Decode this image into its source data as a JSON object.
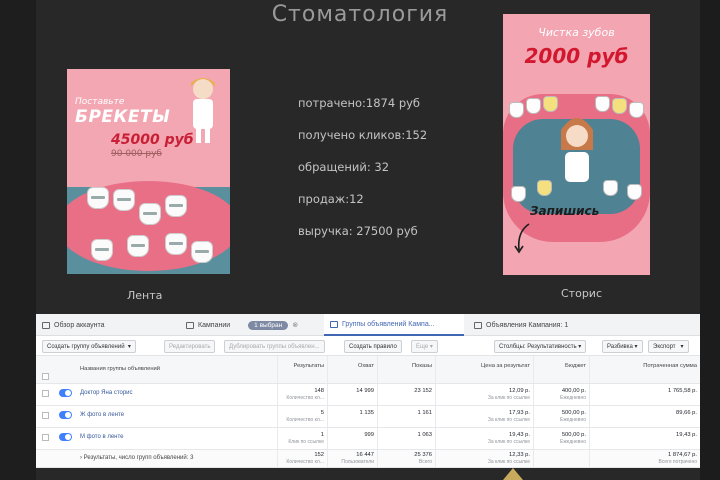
{
  "page": {
    "title": "Стоматология",
    "label_feed": "Лента",
    "label_stories": "Сторис"
  },
  "creative_feed": {
    "line1": "Поставьте",
    "line2": "БРЕКЕТЫ",
    "price": "45000 руб",
    "old_price": "90 000 руб"
  },
  "creative_stories": {
    "line1": "Чистка зубов",
    "price": "2000 руб",
    "cta": "Запишись"
  },
  "stats": [
    "потрачено:1874 руб",
    "получено кликов:152",
    "обращений: 32",
    "продаж:12",
    "выручка: 27500 руб"
  ],
  "ads_manager": {
    "tabs": {
      "overview": "Обзор аккаунта",
      "campaigns": "Кампании",
      "selected": "1 выбран",
      "adsets": "Группы объявлений Кампа...",
      "ads": "Объявления Кампания: 1"
    },
    "toolbar": {
      "create": "Создать группу объявлений",
      "edit": "Редактировать",
      "duplicate": "Дублировать группы объявлен...",
      "rule": "Создать правило",
      "more": "Еще",
      "columns": "Столбцы: Результативность",
      "breakdown": "Разбивка",
      "export": "Экспорт"
    },
    "headers": {
      "name": "Названия группы объявлений",
      "results": "Результаты",
      "reach": "Охват",
      "impressions": "Показы",
      "cost": "Цена за результат",
      "budget": "Бюджет",
      "spent": "Потраченная сумма"
    },
    "rows": [
      {
        "name": "Доктор Яна сторис",
        "results": "148",
        "results_sub": "Количество кл...",
        "reach": "14 999",
        "impressions": "23 152",
        "cost": "12,09 р.",
        "cost_sub": "За клик по ссылке",
        "budget": "400,00 р.",
        "budget_sub": "Ежедневно",
        "spent": "1 765,58 р."
      },
      {
        "name": "Ж фото в ленте",
        "results": "5",
        "results_sub": "Количество кл...",
        "reach": "1 135",
        "impressions": "1 161",
        "cost": "17,93 р.",
        "cost_sub": "За клик по ссылке",
        "budget": "500,00 р.",
        "budget_sub": "Ежедневно",
        "spent": "89,66 р."
      },
      {
        "name": "М фото в ленте",
        "results": "1",
        "results_sub": "Клик по ссылке",
        "reach": "999",
        "impressions": "1 063",
        "cost": "19,43 р.",
        "cost_sub": "За клик по ссылке",
        "budget": "500,00 р.",
        "budget_sub": "Ежедневно",
        "spent": "19,43 р."
      }
    ],
    "summary": {
      "label": "Результаты, число групп объявлений: 3",
      "results": "152",
      "results_sub": "Количество кл...",
      "reach": "16 447",
      "reach_sub": "Пользователи",
      "impressions": "25 376",
      "impressions_sub": "Всего",
      "cost": "12,33 р.",
      "cost_sub": "За клик по ссылке",
      "spent": "1 874,67 р.",
      "spent_sub": "Всего потрачено"
    }
  }
}
